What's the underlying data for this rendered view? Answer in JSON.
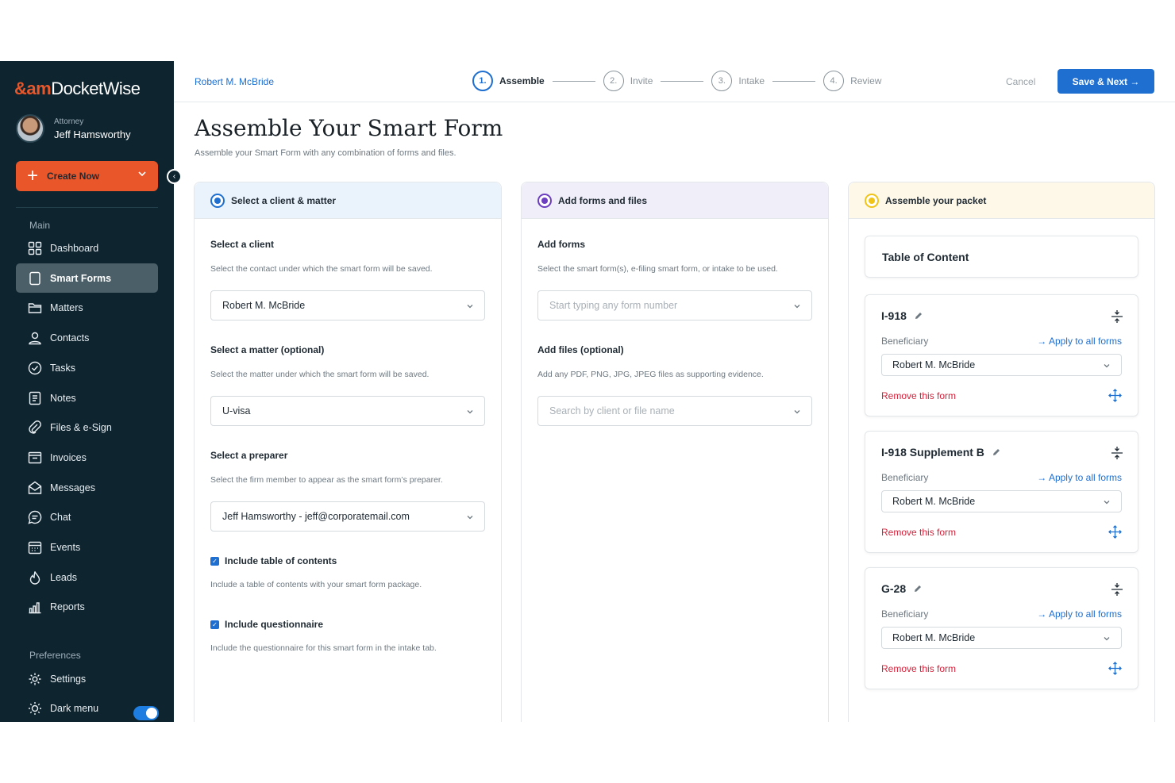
{
  "app": {
    "logo_mark": "&am",
    "logo_text": "DocketWise"
  },
  "user": {
    "role": "Attorney",
    "name": "Jeff Hamsworthy"
  },
  "sidebar": {
    "create_label": "Create Now",
    "main_section": "Main",
    "items": [
      {
        "label": "Dashboard",
        "icon": "grid-icon"
      },
      {
        "label": "Smart Forms",
        "icon": "file-icon",
        "active": true
      },
      {
        "label": "Matters",
        "icon": "folder-icon"
      },
      {
        "label": "Contacts",
        "icon": "person-icon"
      },
      {
        "label": "Tasks",
        "icon": "check-circle-icon"
      },
      {
        "label": "Notes",
        "icon": "notes-icon"
      },
      {
        "label": "Files & e-Sign",
        "icon": "paperclip-icon"
      },
      {
        "label": "Invoices",
        "icon": "invoice-icon"
      },
      {
        "label": "Messages",
        "icon": "mail-icon"
      },
      {
        "label": "Chat",
        "icon": "chat-icon"
      },
      {
        "label": "Events",
        "icon": "calendar-icon"
      },
      {
        "label": "Leads",
        "icon": "flame-icon"
      },
      {
        "label": "Reports",
        "icon": "bar-chart-icon"
      }
    ],
    "pref_section": "Preferences",
    "settings_label": "Settings",
    "dark_menu_label": "Dark menu",
    "dark_menu_on": true
  },
  "topbar": {
    "breadcrumb": "Robert M. McBride",
    "steps": [
      {
        "num": "1.",
        "label": "Assemble",
        "active": true
      },
      {
        "num": "2.",
        "label": "Invite"
      },
      {
        "num": "3.",
        "label": "Intake"
      },
      {
        "num": "4.",
        "label": "Review"
      }
    ],
    "cancel_label": "Cancel",
    "save_label": "Save & Next →"
  },
  "page": {
    "title": "Assemble Your Smart Form",
    "subtitle": "Assemble your Smart Form with any combination of forms and files."
  },
  "col1": {
    "header": "Select a client & matter",
    "client_label": "Select a client",
    "client_help": "Select the contact under which the smart form will be saved.",
    "client_value": "Robert M. McBride",
    "matter_label": "Select a matter (optional)",
    "matter_help": "Select the matter under which the smart form will be saved.",
    "matter_value": "U-visa",
    "preparer_label": "Select a preparer",
    "preparer_help": "Select the firm member to appear as the smart form’s preparer.",
    "preparer_value": "Jeff Hamsworthy - jeff@corporatemail.com",
    "toc_check_label": "Include table of contents",
    "toc_check_help": "Include a table of contents with your smart form package.",
    "quest_check_label": "Include questionnaire",
    "quest_check_help": "Include the questionnaire for this smart form in the intake tab."
  },
  "col2": {
    "header": "Add forms and files",
    "forms_label": "Add forms",
    "forms_help": "Select the smart form(s), e-filing smart form, or intake to be used.",
    "forms_placeholder": "Start typing any form number",
    "files_label": "Add files (optional)",
    "files_help": "Add any PDF, PNG, JPG, JPEG files as supporting evidence.",
    "files_placeholder": "Search by client or file name"
  },
  "col3": {
    "header": "Assemble your packet",
    "toc_title": "Table of Content",
    "forms": [
      {
        "name": "I-918",
        "beneficiary_label": "Beneficiary",
        "apply_label": "Apply to all forms",
        "beneficiary": "Robert M. McBride",
        "remove_label": "Remove this form"
      },
      {
        "name": "I-918 Supplement B",
        "beneficiary_label": "Beneficiary",
        "apply_label": "Apply to all forms",
        "beneficiary": "Robert M. McBride",
        "remove_label": "Remove this form"
      },
      {
        "name": "G-28",
        "beneficiary_label": "Beneficiary",
        "apply_label": "Apply to all forms",
        "beneficiary": "Robert M. McBride",
        "remove_label": "Remove this form"
      }
    ]
  },
  "colors": {
    "sidebar_bg": "#0e2530",
    "accent_orange": "#e8562a",
    "primary_blue": "#1e6fd0",
    "danger_red": "#d4213a",
    "col1_head": "#eaf2fc",
    "col2_head": "#f0eef9",
    "col3_head": "#fdf8e8"
  }
}
